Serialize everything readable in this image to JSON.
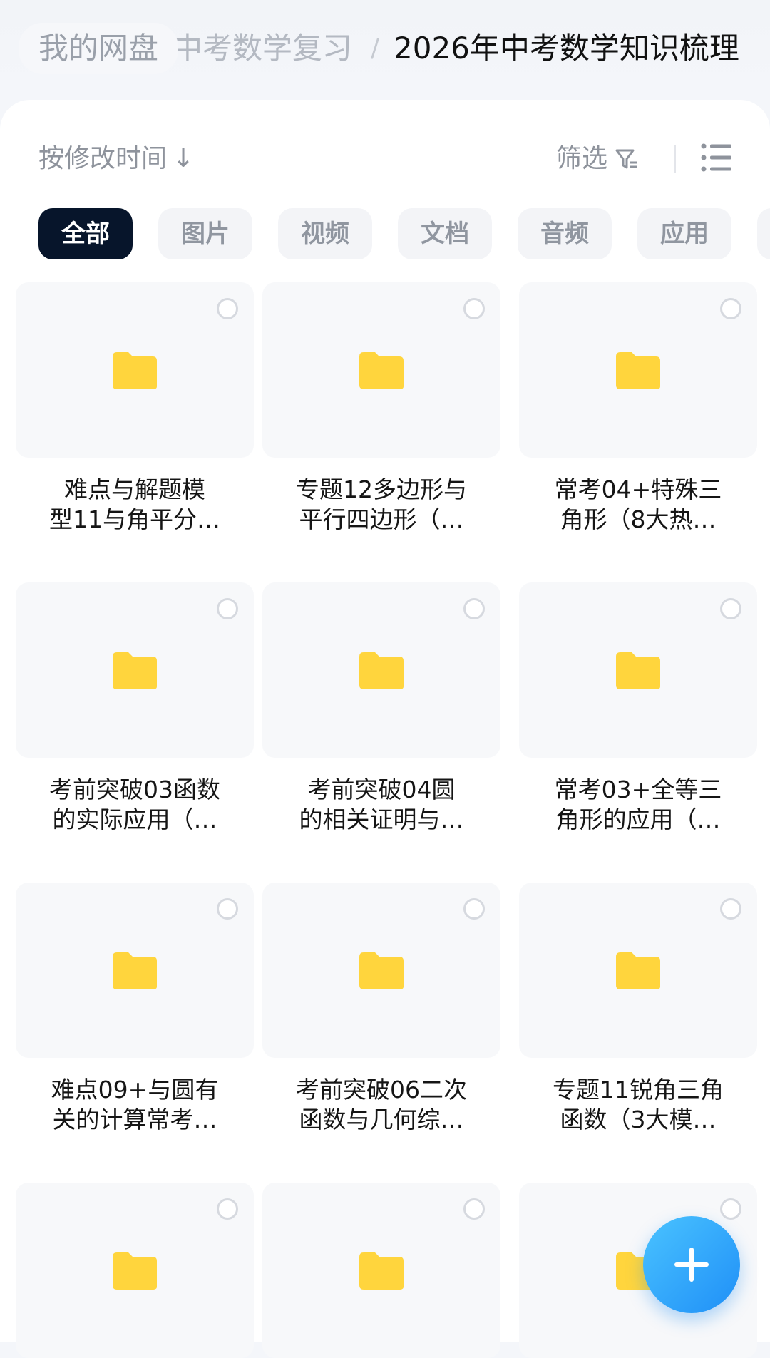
{
  "breadcrumb": {
    "root": "我的网盘",
    "middle": "中考数学复习",
    "separator": "/",
    "current": "2026年中考数学知识梳理"
  },
  "toolbar": {
    "sort_label": "按修改时间",
    "sort_arrow": "↓",
    "filter_label": "筛选",
    "filter_icon": "filter-icon",
    "view_icon": "list-view-icon"
  },
  "tabs": [
    {
      "label": "全部",
      "active": true
    },
    {
      "label": "图片",
      "active": false
    },
    {
      "label": "视频",
      "active": false
    },
    {
      "label": "文档",
      "active": false
    },
    {
      "label": "音频",
      "active": false
    },
    {
      "label": "应用",
      "active": false
    }
  ],
  "folders": [
    {
      "name": "难点与解题模\n型11与角平分…"
    },
    {
      "name": "专题12多边形与\n平行四边形（…"
    },
    {
      "name": "常考04+特殊三\n角形（8大热…"
    },
    {
      "name": "考前突破03函数\n的实际应用（…"
    },
    {
      "name": "考前突破04圆\n的相关证明与…"
    },
    {
      "name": "常考03+全等三\n角形的应用（…"
    },
    {
      "name": "难点09+与圆有\n关的计算常考…"
    },
    {
      "name": "考前突破06二次\n函数与几何综…"
    },
    {
      "name": "专题11锐角三角\n函数（3大模…"
    },
    {
      "name": ""
    },
    {
      "name": ""
    },
    {
      "name": ""
    }
  ],
  "colors": {
    "folder": "#FFD53D",
    "active_tab": "#07152B",
    "fab": "#2A9BF8"
  },
  "fab_icon": "plus-icon"
}
